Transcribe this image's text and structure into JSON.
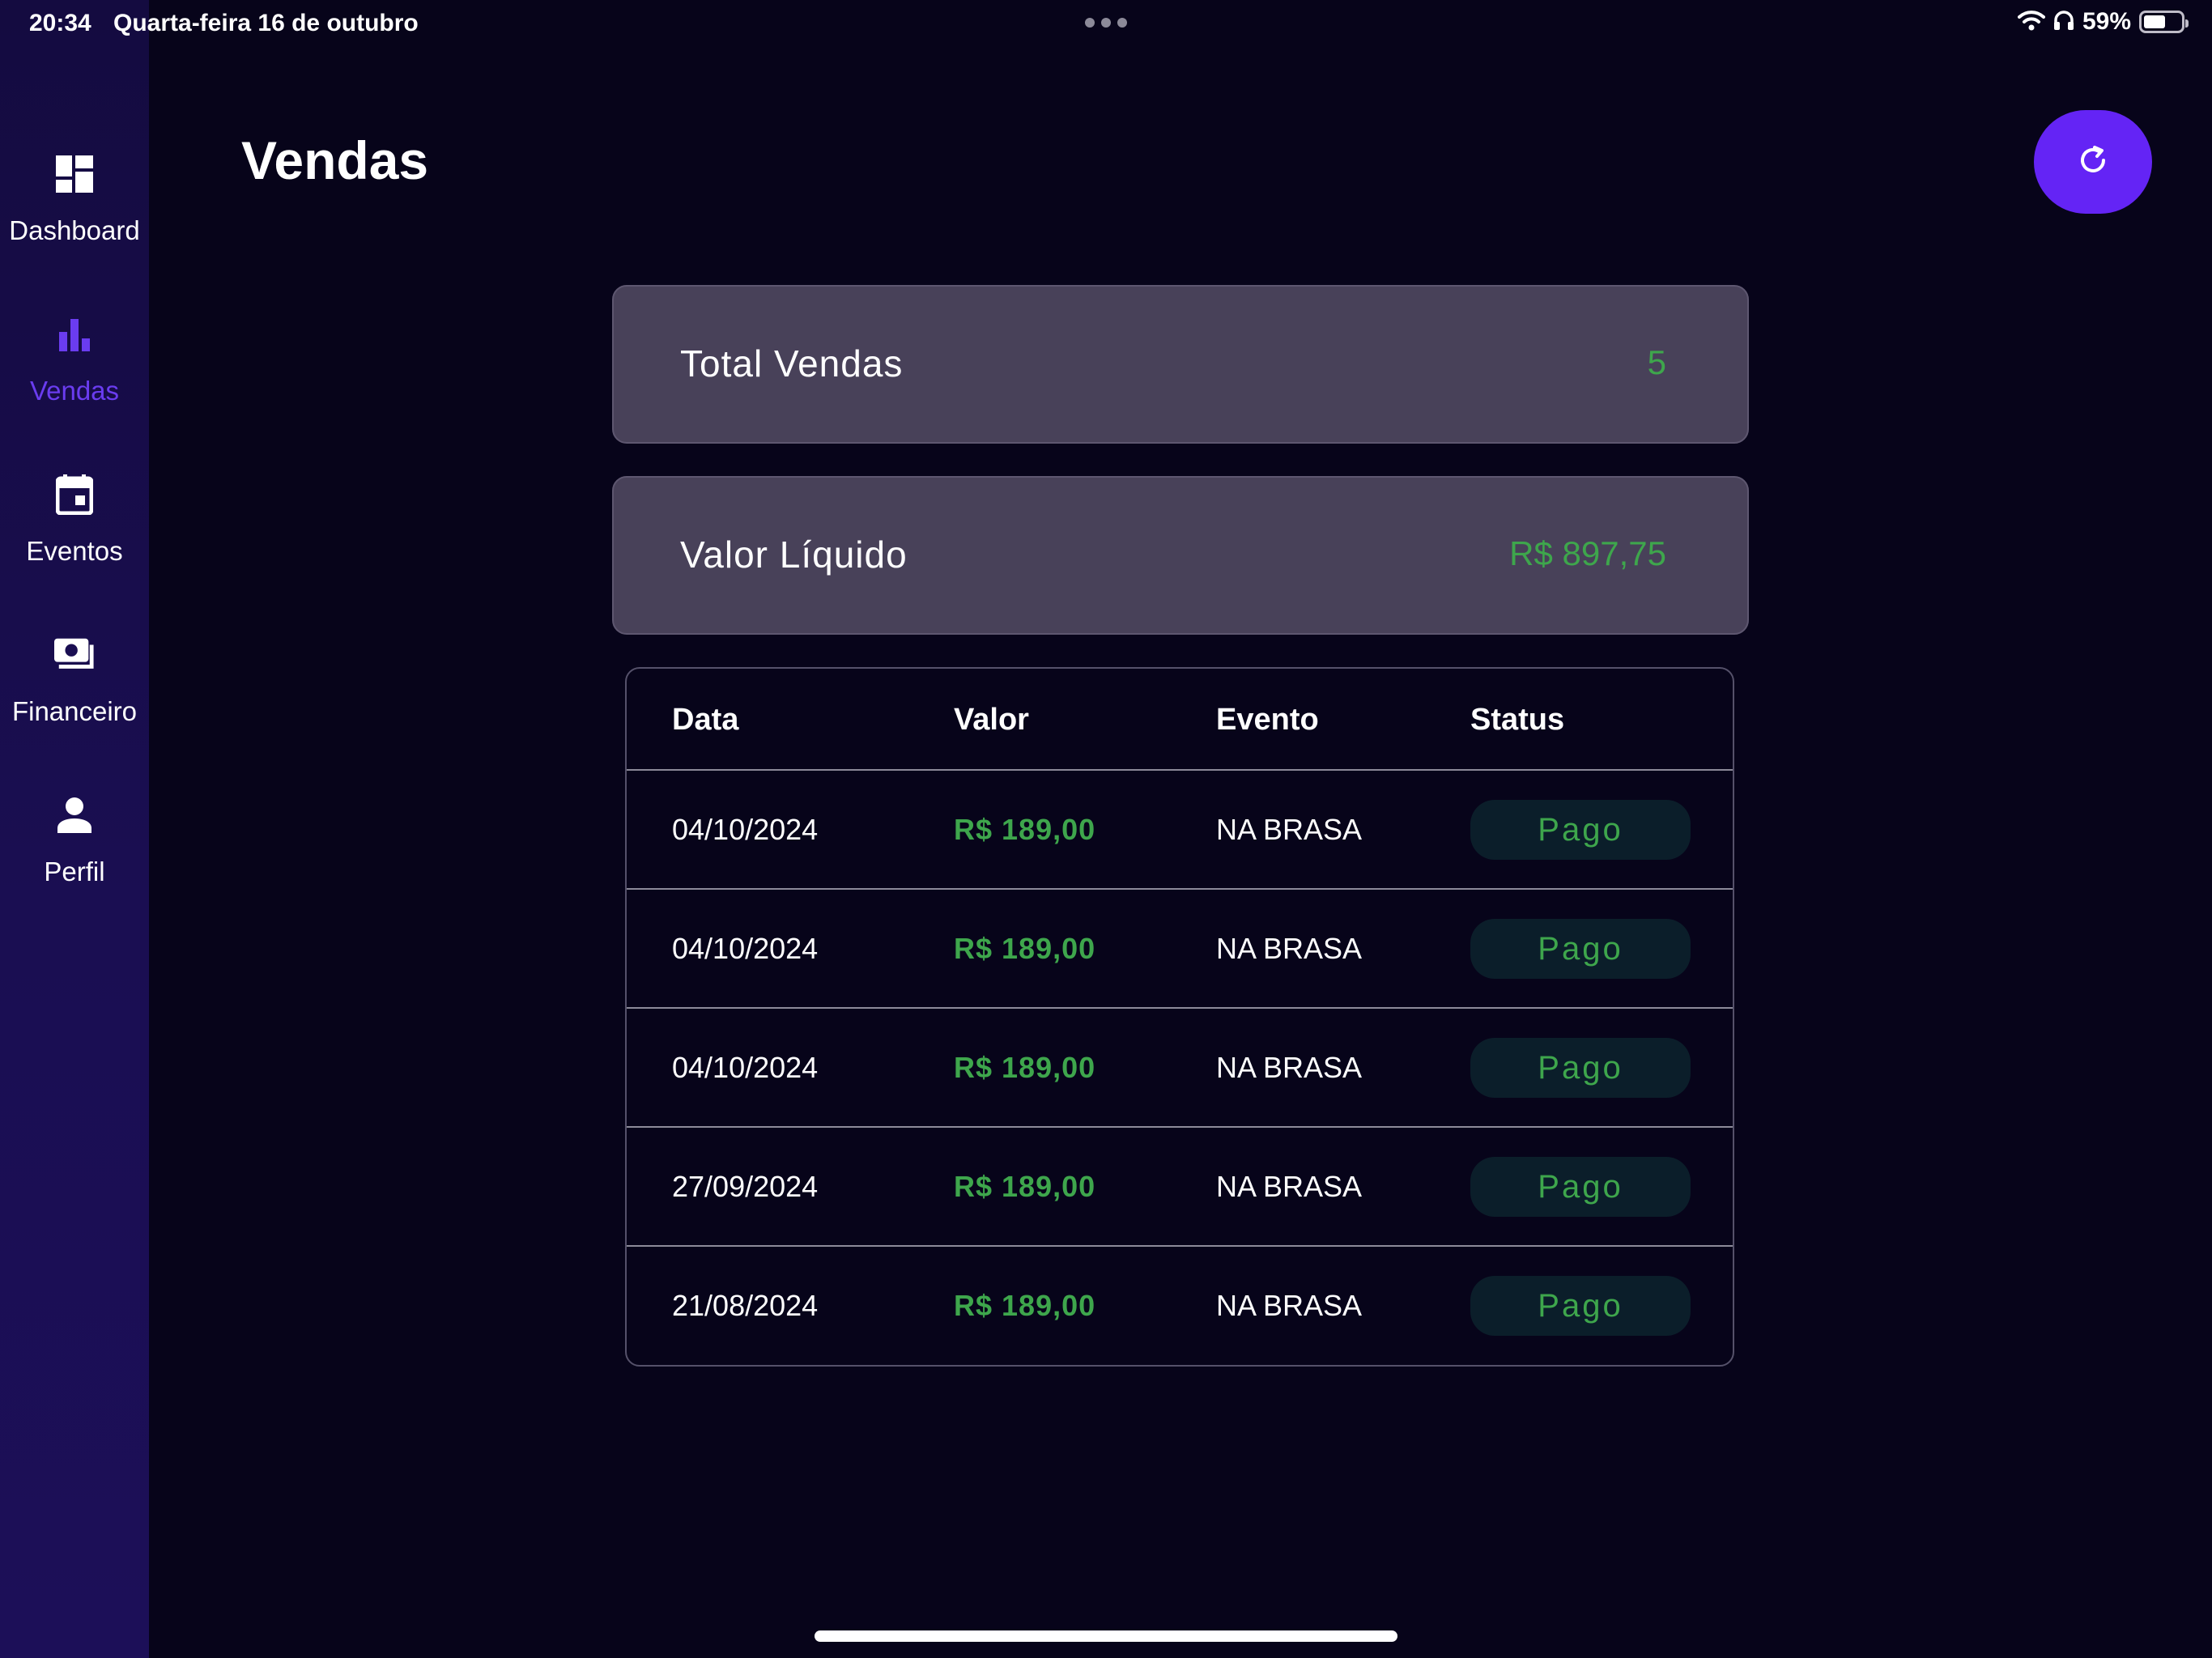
{
  "status_bar": {
    "time": "20:34",
    "date": "Quarta-feira 16 de outubro",
    "battery_pct": "59%",
    "battery_level": 0.59
  },
  "sidebar": {
    "items": [
      {
        "label": "Dashboard",
        "icon": "dashboard-icon",
        "active": false
      },
      {
        "label": "Vendas",
        "icon": "bar-chart-icon",
        "active": true
      },
      {
        "label": "Eventos",
        "icon": "calendar-icon",
        "active": false
      },
      {
        "label": "Financeiro",
        "icon": "money-icon",
        "active": false
      },
      {
        "label": "Perfil",
        "icon": "person-icon",
        "active": false
      }
    ]
  },
  "header": {
    "title": "Vendas",
    "refresh_icon": "refresh-icon"
  },
  "summary": {
    "total_vendas": {
      "label": "Total Vendas",
      "value": "5"
    },
    "valor_liquido": {
      "label": "Valor Líquido",
      "value": "R$ 897,75"
    }
  },
  "table": {
    "headers": [
      "Data",
      "Valor",
      "Evento",
      "Status"
    ],
    "rows": [
      {
        "data": "04/10/2024",
        "valor": "R$ 189,00",
        "evento": "NA BRASA",
        "status": "Pago"
      },
      {
        "data": "04/10/2024",
        "valor": "R$ 189,00",
        "evento": "NA BRASA",
        "status": "Pago"
      },
      {
        "data": "04/10/2024",
        "valor": "R$ 189,00",
        "evento": "NA BRASA",
        "status": "Pago"
      },
      {
        "data": "27/09/2024",
        "valor": "R$ 189,00",
        "evento": "NA BRASA",
        "status": "Pago"
      },
      {
        "data": "21/08/2024",
        "valor": "R$ 189,00",
        "evento": "NA BRASA",
        "status": "Pago"
      }
    ]
  },
  "colors": {
    "background": "#07041a",
    "sidebar": "#1a0e52",
    "accent": "#6424f5",
    "active_nav": "#6a3cf0",
    "positive": "#3ea64c",
    "card": "#484159"
  }
}
